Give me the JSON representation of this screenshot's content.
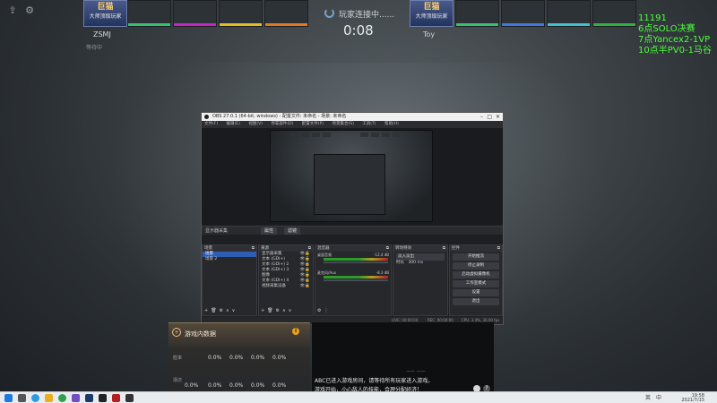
{
  "topbar": {
    "left_icons": [
      "upload-icon",
      "gear-icon"
    ],
    "status_text": "玩家连接中......",
    "timer": "0:08",
    "player_left": {
      "badge": "巨猫",
      "sub": "大师顶级玩家",
      "name": "ZSMJ",
      "small": "等待中"
    },
    "player_right": {
      "badge": "巨猫",
      "sub": "大师顶级玩家",
      "name": "Toy"
    },
    "slot_colors_left": [
      "#38c070",
      "#c028c0",
      "#e0c020",
      "#e07828"
    ],
    "slot_colors_right": [
      "#38c070",
      "#4078e0",
      "#40c0d0",
      "#30b040",
      "#d0d0d0"
    ]
  },
  "green_list": [
    "11191",
    "6点SOLO决赛",
    "7点Yancex2-1VP",
    "10点半PV0-1马谷"
  ],
  "obs": {
    "title": "OBS 27.0.1 (64-bit, windows) - 配置文件: 未命名 - 场景: 未命名",
    "menu": [
      "文件(F)",
      "编辑(E)",
      "视图(V)",
      "停靠部件(D)",
      "配置文件(P)",
      "场景集合(S)",
      "工具(T)",
      "帮助(H)"
    ],
    "toolbar": {
      "label": "显示器采集",
      "props": "属性",
      "filters": "滤镜"
    },
    "docks": {
      "scenes": {
        "title": "场景",
        "items": [
          "场景",
          "场景 2"
        ]
      },
      "sources": {
        "title": "来源",
        "items": [
          "显示器采集",
          "文本 (GDI+)",
          "文本 (GDI+) 2",
          "文本 (GDI+) 3",
          "图像",
          "文本 (GDI+) 4",
          "视频采集设备"
        ]
      },
      "mixer": {
        "title": "混音器",
        "tracks": [
          {
            "name": "桌面音频",
            "db": "-12.4 dB"
          },
          {
            "name": "麦克风/Aux",
            "db": "-8.3 dB"
          }
        ]
      },
      "transitions": {
        "title": "转场特效",
        "value": "淡入淡出",
        "duration_label": "时长",
        "duration": "300 ms"
      },
      "controls": {
        "title": "控件",
        "buttons": [
          "开始推流",
          "停止录制",
          "启动虚拟摄像机",
          "工作室模式",
          "设置",
          "退出"
        ]
      }
    },
    "status": {
      "live": "LIVE: 00:00:00",
      "rec": "REC: 00:00:00",
      "cpu": "CPU: 3.4%, 30.00 fps"
    }
  },
  "panel": {
    "title": "游戏内数据",
    "rows": [
      {
        "label": "胜率",
        "values": [
          "0.0%",
          "0.0%",
          "0.0%",
          "0.0%",
          "0.0%"
        ]
      },
      {
        "label": "场次",
        "values": [
          "0.0%",
          "0.0%",
          "0.0%",
          "0.0%",
          "0.0%"
        ]
      }
    ]
  },
  "chat": {
    "separator": "—— ——",
    "lines": [
      "ABC已进入游戏房间，请等待所有玩家进入游戏。",
      "游戏开始，小心敌人的技能，合理分配经济！"
    ],
    "help": "?"
  },
  "taskbar": {
    "time": "19:58",
    "date": "2021/7/15",
    "lang": "中",
    "ime": "英"
  }
}
